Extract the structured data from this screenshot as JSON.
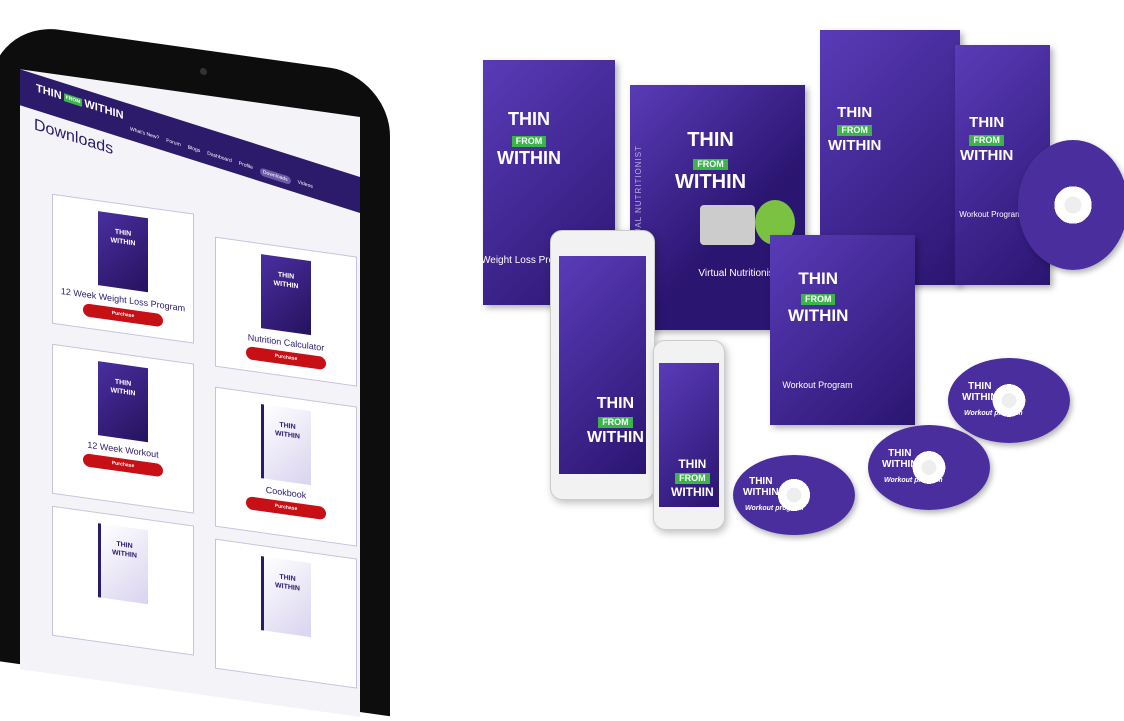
{
  "logo": {
    "thin": "THIN",
    "from": "FROM",
    "within": "WITHIN"
  },
  "nav": [
    "What's New?",
    "Forum",
    "Blogs",
    "Dashboard",
    "Profile",
    "Downloads",
    "Videos"
  ],
  "page_title": "Downloads",
  "cards": [
    {
      "name": "12 Week Weight Loss Program",
      "button": "Purchase"
    },
    {
      "name": "Nutrition Calculator",
      "button": "Purchase"
    },
    {
      "name": "12 Week Workout",
      "button": "Purchase"
    },
    {
      "name": "Cookbook",
      "button": "Purchase"
    },
    {
      "name": "",
      "button": ""
    },
    {
      "name": "",
      "button": ""
    }
  ],
  "products": {
    "weight_loss": "Weight Loss Program",
    "nutritionist": "Virtual Nutritionist",
    "nutritionist_spine": "VIRTUAL NUTRITIONIST",
    "workout_box": "Workout Program",
    "workout_case": "Workout Program",
    "disc_label": "Workout program"
  },
  "colors": {
    "brand": "#2c1a6b",
    "accent": "#3bb54a",
    "button": "#c70f16"
  }
}
